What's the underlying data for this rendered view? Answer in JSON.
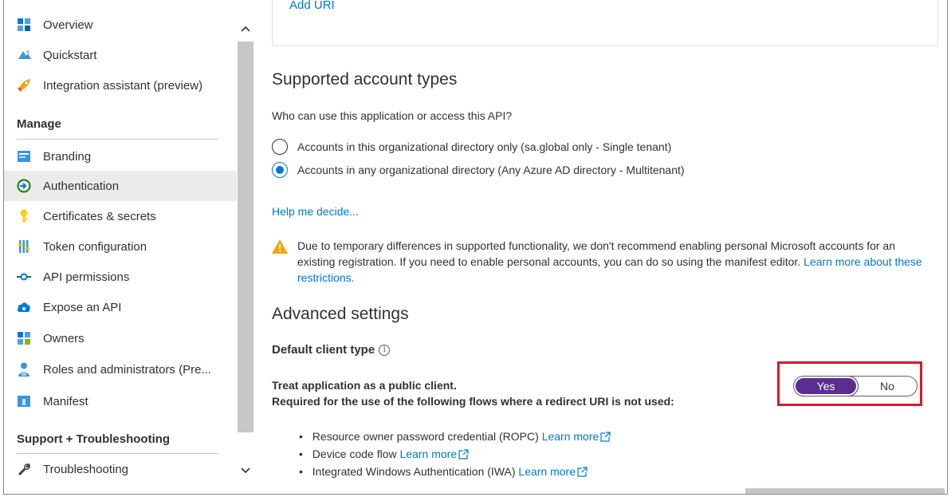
{
  "sidebar": {
    "items_top": [
      {
        "label": "Overview",
        "icon": "overview-icon"
      },
      {
        "label": "Quickstart",
        "icon": "quickstart-icon"
      },
      {
        "label": "Integration assistant (preview)",
        "icon": "rocket-icon"
      }
    ],
    "manage_title": "Manage",
    "manage_items": [
      {
        "label": "Branding",
        "icon": "branding-icon"
      },
      {
        "label": "Authentication",
        "icon": "authentication-icon",
        "active": true
      },
      {
        "label": "Certificates & secrets",
        "icon": "key-icon"
      },
      {
        "label": "Token configuration",
        "icon": "token-config-icon"
      },
      {
        "label": "API permissions",
        "icon": "api-permissions-icon"
      },
      {
        "label": "Expose an API",
        "icon": "cloud-icon"
      },
      {
        "label": "Owners",
        "icon": "owners-icon"
      },
      {
        "label": "Roles and administrators (Pre...",
        "icon": "roles-icon"
      },
      {
        "label": "Manifest",
        "icon": "manifest-icon"
      }
    ],
    "support_title": "Support + Troubleshooting",
    "support_items": [
      {
        "label": "Troubleshooting",
        "icon": "wrench-icon"
      }
    ]
  },
  "main": {
    "add_uri": "Add URI",
    "supported_title": "Supported account types",
    "question": "Who can use this application or access this API?",
    "radio_single": "Accounts in this organizational directory only (sa.global only - Single tenant)",
    "radio_multi": "Accounts in any organizational directory (Any Azure AD directory - Multitenant)",
    "selected_radio": "multi",
    "help_link": "Help me decide...",
    "warning_text": "Due to temporary differences in supported functionality, we don't recommend enabling personal Microsoft accounts for an existing registration. If you need to enable personal accounts, you can do so using the manifest editor.",
    "warning_link": "Learn more about these restrictions.",
    "advanced_title": "Advanced settings",
    "default_client_type": "Default client type",
    "info_glyph": "i",
    "treat_line1": "Treat application as a public client.",
    "treat_line2": "Required for the use of the following flows where a redirect URI is not used:",
    "toggle_yes": "Yes",
    "toggle_no": "No",
    "toggle_selected": "Yes",
    "flows": [
      {
        "text": "Resource owner password credential (ROPC)",
        "link": "Learn more"
      },
      {
        "text": "Device code flow",
        "link": "Learn more"
      },
      {
        "text": "Integrated Windows Authentication (IWA)",
        "link": "Learn more"
      }
    ]
  },
  "colors": {
    "accent": "#0078d4",
    "toggle_on": "#5c2d91",
    "highlight": "#d41b2c",
    "warning": "#f7a20c"
  }
}
